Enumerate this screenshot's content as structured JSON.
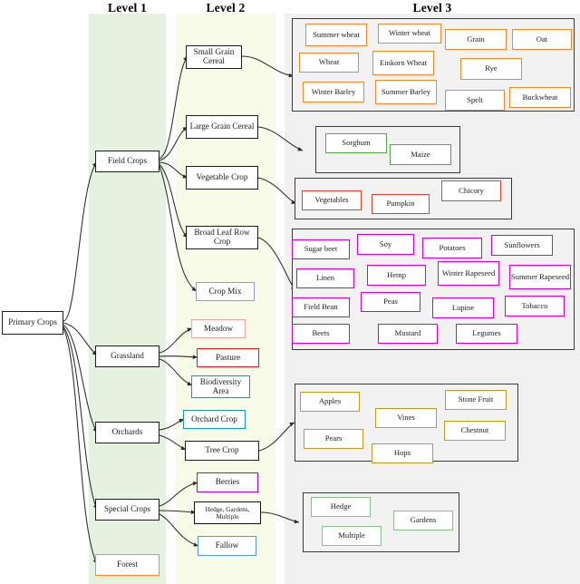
{
  "columns": [
    {
      "key": "level1",
      "label": "Level 1",
      "bg": "#e6f2e0"
    },
    {
      "key": "level2",
      "label": "Level 2",
      "bg": "#f8fbe8"
    },
    {
      "key": "level3",
      "label": "Level 3",
      "bg": "#f0f0f0"
    }
  ],
  "root": {
    "label": "Primary Crops"
  },
  "level1": [
    {
      "label": "Field Crops",
      "color": "#1b1b1b"
    },
    {
      "label": "Grassland",
      "color": "#1b1b1b"
    },
    {
      "label": "Orchards",
      "color": "#1b1b1b"
    },
    {
      "label": "Special Crops",
      "color": "#1b1b1b"
    },
    {
      "label": "Forest",
      "color": "#f59220"
    }
  ],
  "level2": [
    {
      "label": "Small Grain Cereal",
      "color": "#1b1b1b"
    },
    {
      "label": "Large Grain Cereal",
      "color": "#1b1b1b"
    },
    {
      "label": "Vegetable Crop",
      "color": "#1b1b1b"
    },
    {
      "label": "Broad Leaf Row Crop",
      "color": "#1b1b1b"
    },
    {
      "label": "Crop Mix",
      "color": "#9a99d6"
    },
    {
      "label": "Meadow",
      "color": "#f0a7a2"
    },
    {
      "label": "Pasture",
      "color": "#e01b12"
    },
    {
      "label": "Biodiversity Area",
      "color": "#51808e"
    },
    {
      "label": "Orchard Crop",
      "color": "#1598ad"
    },
    {
      "label": "Tree Crop",
      "color": "#1b1b1b"
    },
    {
      "label": "Berries",
      "color": "#b400d8"
    },
    {
      "label": "Hedge, Gardens, Multiple",
      "color": "#111111"
    },
    {
      "label": "Fallow",
      "color": "#5b9bd5"
    }
  ],
  "level3_groups": [
    {
      "key": "small-grain-cereal",
      "accent": "#ed8b2b",
      "items": [
        "Summer wheat",
        "Winter wheat",
        "Grain",
        "Oat",
        "Wheat",
        "Einkorn Wheat",
        "Rye",
        "Winter Barley",
        "Summer Barley",
        "Spelt",
        "Buckwheat"
      ]
    },
    {
      "key": "large-grain-cereal",
      "accent": "#55a747",
      "items": [
        "Sorghum",
        "Maize"
      ]
    },
    {
      "key": "vegetable-crop",
      "accent": "#e1432a",
      "items": [
        "Vegetables",
        "Pumpkin",
        "Chicory"
      ]
    },
    {
      "key": "broad-leaf-row-crop",
      "accent": "#d400d4",
      "items": [
        "Sugar beet",
        "Soy",
        "Potatoes",
        "Sunflowers",
        "Linen",
        "Hemp",
        "Winter Rapeseed",
        "Summer Rapeseed",
        "Field Bean",
        "Peas",
        "Lupine",
        "Tobacco",
        "Beets",
        "Mustard",
        "Legumes"
      ]
    },
    {
      "key": "tree-crop",
      "accent": "#c89a18",
      "items": [
        "Apples",
        "Vines",
        "Stone Fruit",
        "Pears",
        "Hops",
        "Chestnut"
      ]
    },
    {
      "key": "hedge-gardens-multiple",
      "accent": "#87c187",
      "items": [
        "Hedge",
        "Gardens",
        "Multiple"
      ]
    }
  ]
}
